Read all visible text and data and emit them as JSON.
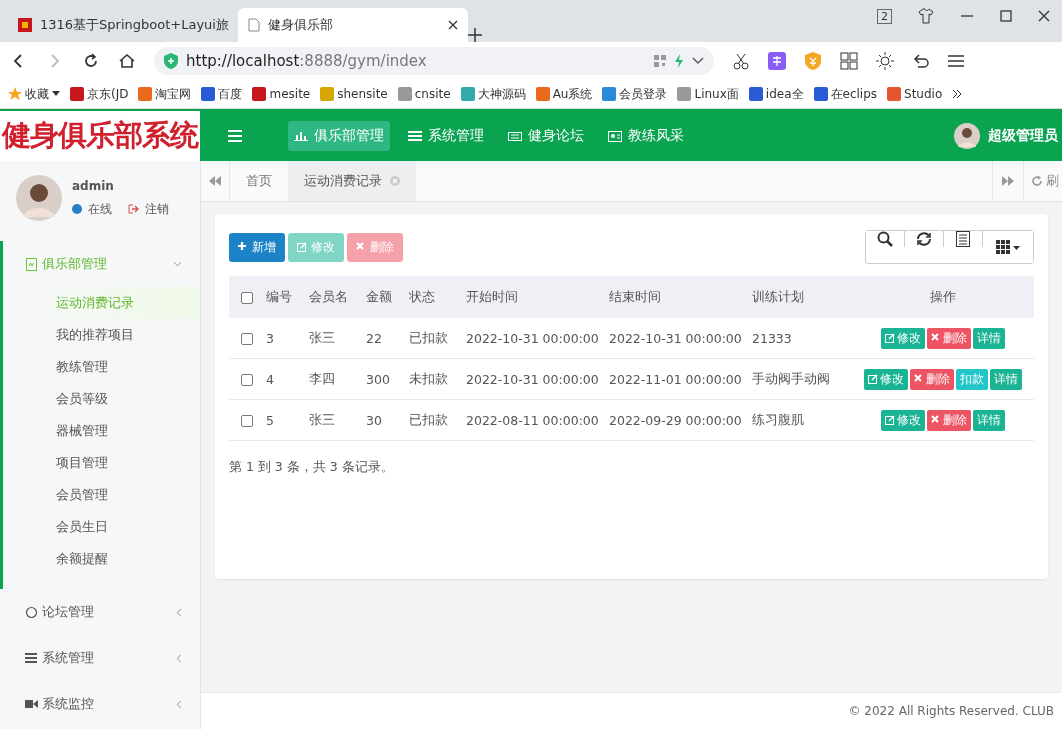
{
  "browser": {
    "tabs": [
      {
        "title": "1316基于Springboot+Layui旅",
        "selected": false
      },
      {
        "title": "健身俱乐部",
        "selected": true
      }
    ],
    "url": {
      "host": "http://localhost",
      "rest": ":8888/gym/index"
    },
    "favorites": "收藏",
    "bookmarks": [
      "京东(JD",
      "淘宝网",
      "百度",
      "mesite",
      "shensite",
      "cnsite",
      "大神源码",
      "Au系统",
      "会员登录",
      "Linux面",
      "idea全",
      "在eclips",
      "Studio"
    ],
    "tab_count": "2"
  },
  "app": {
    "logo": "健身俱乐部系统",
    "top_nav": [
      {
        "label": "俱乐部管理",
        "selected": true,
        "kind": "chart"
      },
      {
        "label": "系统管理",
        "selected": false,
        "kind": "list"
      },
      {
        "label": "健身论坛",
        "selected": false,
        "kind": "keyboard"
      },
      {
        "label": "教练风采",
        "selected": false,
        "kind": "card"
      }
    ],
    "user_role": "超级管理员"
  },
  "sidebar": {
    "user": {
      "name": "admin",
      "status": "在线",
      "logout": "注销"
    },
    "menu": [
      {
        "label": "俱乐部管理",
        "kind": "doc",
        "expanded": true,
        "children": [
          {
            "label": "运动消费记录",
            "selected": true
          },
          {
            "label": "我的推荐项目",
            "selected": false
          },
          {
            "label": "教练管理",
            "selected": false
          },
          {
            "label": "会员等级",
            "selected": false
          },
          {
            "label": "器械管理",
            "selected": false
          },
          {
            "label": "项目管理",
            "selected": false
          },
          {
            "label": "会员管理",
            "selected": false
          },
          {
            "label": "会员生日",
            "selected": false
          },
          {
            "label": "余额提醒",
            "selected": false
          }
        ]
      },
      {
        "label": "论坛管理",
        "kind": "circle",
        "expanded": false
      },
      {
        "label": "系统管理",
        "kind": "list",
        "expanded": false
      },
      {
        "label": "系统监控",
        "kind": "video",
        "expanded": false
      }
    ]
  },
  "page_tabs": [
    {
      "label": "首页",
      "selected": false,
      "closable": false
    },
    {
      "label": "运动消费记录",
      "selected": true,
      "closable": true
    }
  ],
  "refresh": "刷",
  "toolbar": [
    {
      "label": "新增",
      "kind": "add",
      "disabled": false
    },
    {
      "label": "修改",
      "kind": "edit",
      "disabled": true
    },
    {
      "label": "删除",
      "kind": "delete",
      "disabled": true
    }
  ],
  "table": {
    "columns": [
      "编号",
      "会员名",
      "金额",
      "状态",
      "开始时间",
      "结束时间",
      "训练计划",
      "操作"
    ],
    "rows": [
      {
        "checked": false,
        "cells": [
          "3",
          "张三",
          "22",
          "已扣款",
          "2022-10-31 00:00:00",
          "2022-10-31 00:00:00",
          "21333"
        ],
        "actions": [
          {
            "label": "修改",
            "kind": "edit"
          },
          {
            "label": "删除",
            "kind": "delete"
          },
          {
            "label": "详情",
            "kind": "detail"
          }
        ]
      },
      {
        "checked": false,
        "cells": [
          "4",
          "李四",
          "300",
          "未扣款",
          "2022-10-31 00:00:00",
          "2022-11-01 00:00:00",
          "手动阀手动阀"
        ],
        "actions": [
          {
            "label": "修改",
            "kind": "edit"
          },
          {
            "label": "删除",
            "kind": "delete"
          },
          {
            "label": "扣款",
            "kind": "deduct"
          },
          {
            "label": "详情",
            "kind": "detail"
          }
        ]
      },
      {
        "checked": false,
        "cells": [
          "5",
          "张三",
          "30",
          "已扣款",
          "2022-08-11 00:00:00",
          "2022-09-29 00:00:00",
          "练习腹肌"
        ],
        "actions": [
          {
            "label": "修改",
            "kind": "edit"
          },
          {
            "label": "删除",
            "kind": "delete"
          },
          {
            "label": "详情",
            "kind": "detail"
          }
        ]
      }
    ],
    "all_checked": false
  },
  "pagination": "第 1 到 3 条，共 3 条记录。",
  "footer": "© 2022 All Rights Reserved. CLUB"
}
